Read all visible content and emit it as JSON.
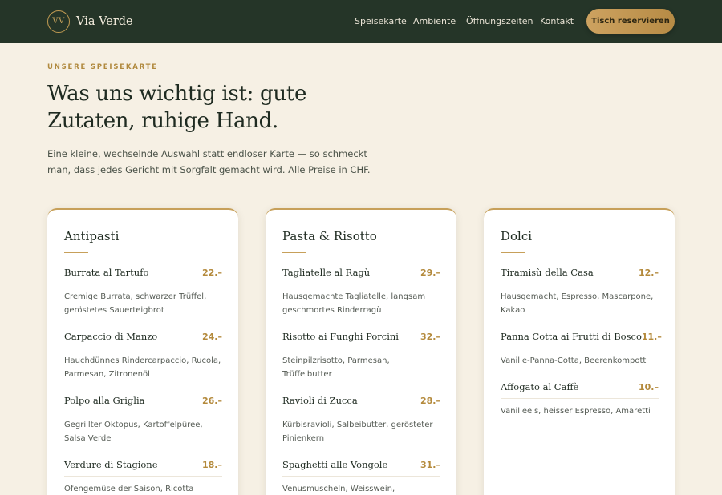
{
  "header": {
    "logo_mark": "VV",
    "brand_name": "Via Verde",
    "nav": [
      "Speisekarte",
      "Ambiente",
      "Öffnungszeiten",
      "Kontakt"
    ],
    "cta_label": "Tisch reservieren"
  },
  "hero": {
    "eyebrow": "UNSERE SPEISEKARTE",
    "title": "Was uns wichtig ist: gute Zutaten, ruhige Hand.",
    "lead": "Eine kleine, wechselnde Auswahl statt endloser Karte — so schmeckt man, dass jedes Gericht mit Sorgfalt gemacht wird. Alle Preise in CHF."
  },
  "menu": [
    {
      "title": "Antipasti",
      "dishes": [
        {
          "name": "Burrata al Tartufo",
          "price": "22.–",
          "desc": "Cremige Burrata, schwarzer Trüffel, geröstetes Sauerteigbrot"
        },
        {
          "name": "Carpaccio di Manzo",
          "price": "24.–",
          "desc": "Hauchdünnes Rindercarpaccio, Rucola, Parmesan, Zitronenöl"
        },
        {
          "name": "Polpo alla Griglia",
          "price": "26.–",
          "desc": "Gegrillter Oktopus, Kartoffelpüree, Salsa Verde"
        },
        {
          "name": "Verdure di Stagione",
          "price": "18.–",
          "desc": "Ofengemüse der Saison, Ricotta salata, Kräuteröl"
        }
      ]
    },
    {
      "title": "Pasta & Risotto",
      "dishes": [
        {
          "name": "Tagliatelle al Ragù",
          "price": "29.–",
          "desc": "Hausgemachte Tagliatelle, langsam geschmortes Rinderragù"
        },
        {
          "name": "Risotto ai Funghi Porcini",
          "price": "32.–",
          "desc": "Steinpilzrisotto, Parmesan, Trüffelbutter"
        },
        {
          "name": "Ravioli di Zucca",
          "price": "28.–",
          "desc": "Kürbisravioli, Salbeibutter, gerösteter Pinienkern"
        },
        {
          "name": "Spaghetti alle Vongole",
          "price": "31.–",
          "desc": "Venusmuscheln, Weisswein, Knoblauch, Petersilie"
        }
      ]
    },
    {
      "title": "Dolci",
      "dishes": [
        {
          "name": "Tiramisù della Casa",
          "price": "12.–",
          "desc": "Hausgemacht, Espresso, Mascarpone, Kakao"
        },
        {
          "name": "Panna Cotta ai Frutti di Bosco",
          "price": "11.–",
          "desc": "Vanille-Panna-Cotta, Beerenkompott"
        },
        {
          "name": "Affogato al Caffè",
          "price": "10.–",
          "desc": "Vanilleeis, heisser Espresso, Amaretti"
        }
      ]
    }
  ],
  "colors": {
    "header_bg": "#253528",
    "page_bg": "#f6f0e4",
    "accent_gold": "#c7a05a",
    "price": "#b48a3c",
    "text_dark": "#1f2b21"
  }
}
